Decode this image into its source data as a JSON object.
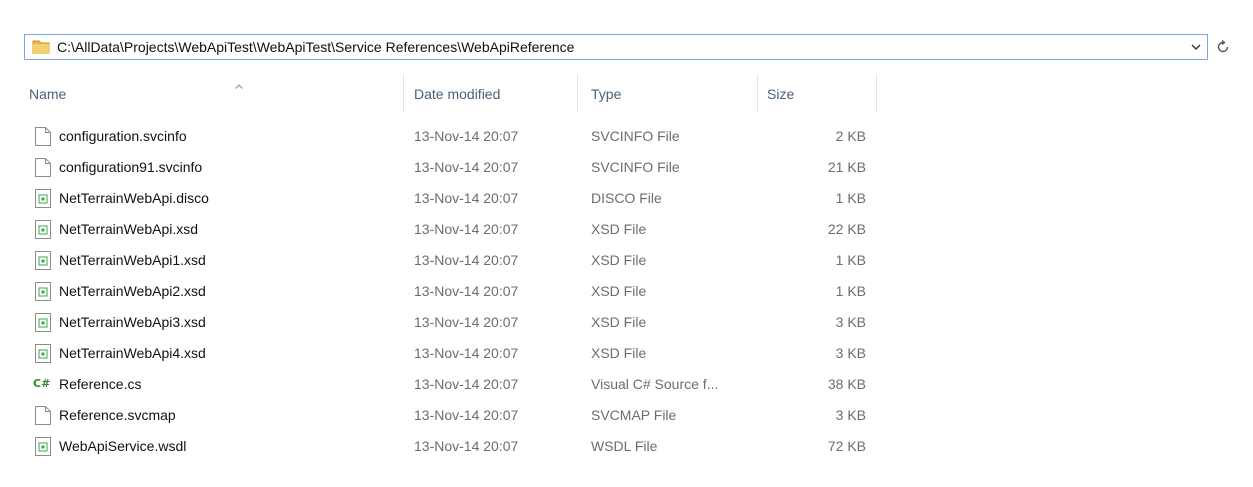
{
  "address_bar": {
    "path": "C:\\AllData\\Projects\\WebApiTest\\WebApiTest\\Service References\\WebApiReference",
    "folder_icon": "folder-icon",
    "dropdown_icon": "chevron-down-icon",
    "refresh_icon": "refresh-icon"
  },
  "columns": {
    "name": "Name",
    "date_modified": "Date modified",
    "type": "Type",
    "size": "Size"
  },
  "sort_indicator": "sort-ascending-icon",
  "files": [
    {
      "name": "configuration.svcinfo",
      "date": "13-Nov-14 20:07",
      "type": "SVCINFO File",
      "size": "2 KB",
      "icon": "blank-file-icon"
    },
    {
      "name": "configuration91.svcinfo",
      "date": "13-Nov-14 20:07",
      "type": "SVCINFO File",
      "size": "21 KB",
      "icon": "blank-file-icon"
    },
    {
      "name": "NetTerrainWebApi.disco",
      "date": "13-Nov-14 20:07",
      "type": "DISCO File",
      "size": "1 KB",
      "icon": "xml-file-icon"
    },
    {
      "name": "NetTerrainWebApi.xsd",
      "date": "13-Nov-14 20:07",
      "type": "XSD File",
      "size": "22 KB",
      "icon": "xml-file-icon"
    },
    {
      "name": "NetTerrainWebApi1.xsd",
      "date": "13-Nov-14 20:07",
      "type": "XSD File",
      "size": "1 KB",
      "icon": "xml-file-icon"
    },
    {
      "name": "NetTerrainWebApi2.xsd",
      "date": "13-Nov-14 20:07",
      "type": "XSD File",
      "size": "1 KB",
      "icon": "xml-file-icon"
    },
    {
      "name": "NetTerrainWebApi3.xsd",
      "date": "13-Nov-14 20:07",
      "type": "XSD File",
      "size": "3 KB",
      "icon": "xml-file-icon"
    },
    {
      "name": "NetTerrainWebApi4.xsd",
      "date": "13-Nov-14 20:07",
      "type": "XSD File",
      "size": "3 KB",
      "icon": "xml-file-icon"
    },
    {
      "name": "Reference.cs",
      "date": "13-Nov-14 20:07",
      "type": "Visual C# Source f...",
      "size": "38 KB",
      "icon": "csharp-file-icon",
      "icon_text": "C#"
    },
    {
      "name": "Reference.svcmap",
      "date": "13-Nov-14 20:07",
      "type": "SVCMAP File",
      "size": "3 KB",
      "icon": "blank-file-icon"
    },
    {
      "name": "WebApiService.wsdl",
      "date": "13-Nov-14 20:07",
      "type": "WSDL File",
      "size": "72 KB",
      "icon": "xml-file-icon"
    }
  ],
  "colors": {
    "header_text": "#4c607a",
    "address_border": "#7aa7d9",
    "csharp_icon": "#2d8a2d",
    "xml_badge": "#3aa84a"
  }
}
